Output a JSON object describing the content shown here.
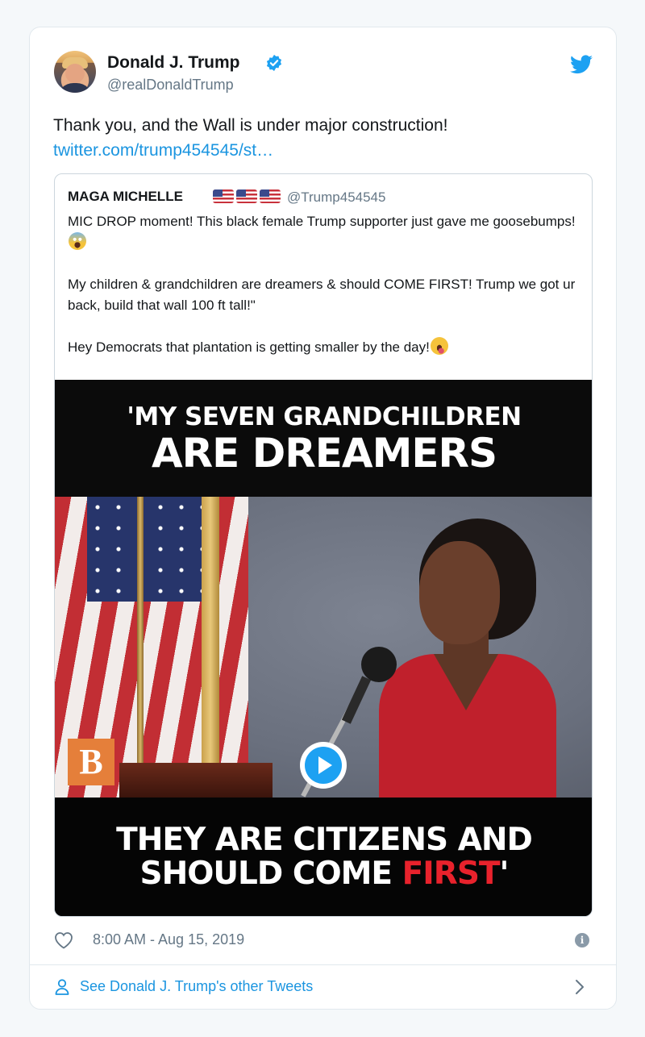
{
  "author": {
    "name": "Donald J. Trump",
    "handle": "@realDonaldTrump"
  },
  "tweet": {
    "text": "Thank you, and the Wall is under major construction!",
    "link": "twitter.com/trump454545/st…"
  },
  "quoted": {
    "name": "MAGA MICHELLE",
    "handle": "@Trump454545",
    "para1": "MIC DROP moment! This black female Trump supporter just gave me goosebumps!",
    "para2": "My children & grandchildren are dreamers & should COME FIRST! Trump we got ur back, build that wall 100 ft tall!\"",
    "para3": "Hey Democrats that plantation is getting smaller by the day!"
  },
  "video": {
    "caption_top_line1": "'MY SEVEN GRANDCHILDREN",
    "caption_top_line2": "ARE DREAMERS",
    "caption_bottom_line1": "THEY ARE CITIZENS AND",
    "caption_bottom_line2_white": "SHOULD COME ",
    "caption_bottom_line2_red": "FIRST",
    "caption_bottom_line2_end": "'",
    "logo_letter": "B"
  },
  "meta": {
    "timestamp": "8:00 AM - Aug 15, 2019",
    "info_glyph": "i"
  },
  "footer": {
    "label": "See Donald J. Trump's other Tweets"
  },
  "colors": {
    "link_blue": "#1b95e0",
    "twitter_blue": "#1da1f2",
    "caption_red": "#e8222c",
    "secondary_text": "#657786"
  },
  "icons": [
    "verified-badge-icon",
    "twitter-bird-icon",
    "play-icon",
    "heart-icon",
    "info-icon",
    "person-icon",
    "chevron-right-icon",
    "us-flag-emoji",
    "scream-emoji",
    "tongue-wink-emoji"
  ]
}
